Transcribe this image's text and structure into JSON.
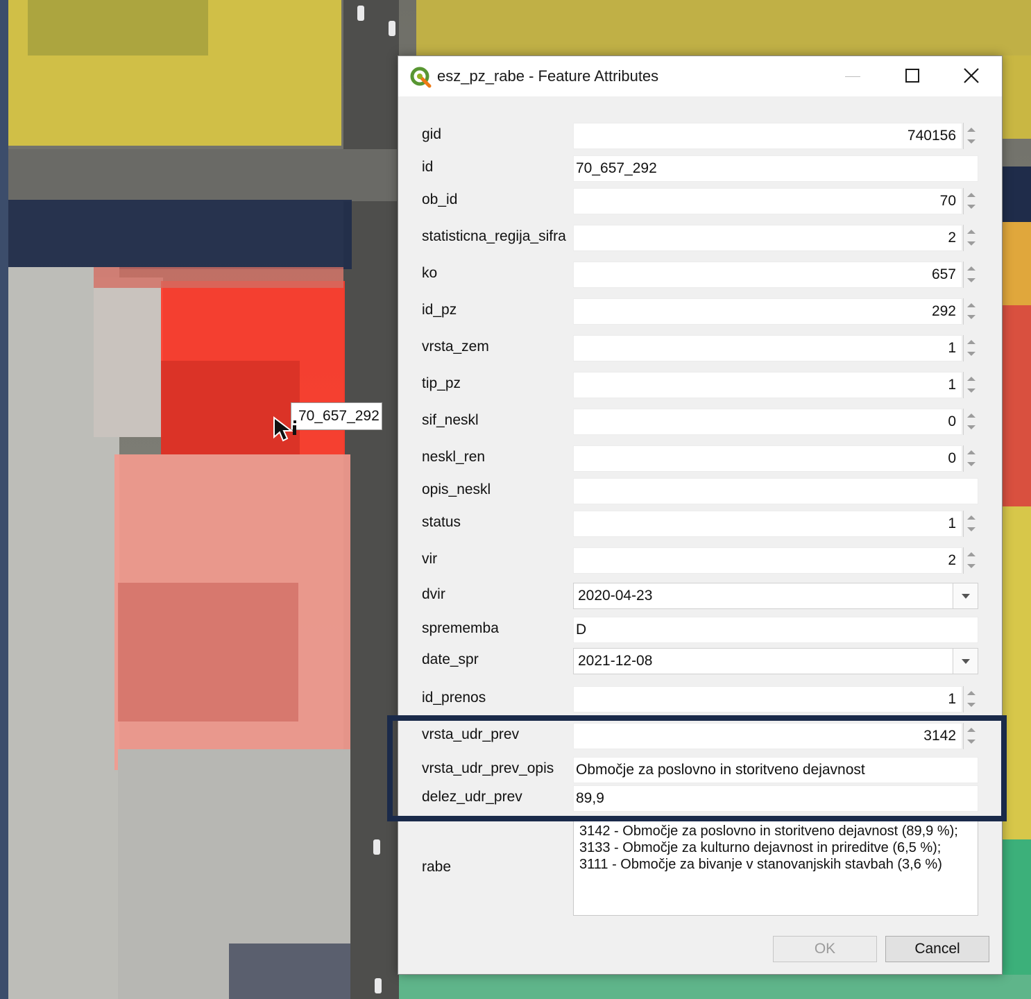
{
  "dialog": {
    "title": "esz_pz_rabe - Feature Attributes",
    "fields": [
      {
        "label": "gid",
        "value": "740156",
        "kind": "spin"
      },
      {
        "label": "id",
        "value": "70_657_292",
        "kind": "text"
      },
      {
        "label": "ob_id",
        "value": "70",
        "kind": "spin"
      },
      {
        "label": "statisticna_regija_sifra",
        "value": "2",
        "kind": "spin"
      },
      {
        "label": "ko",
        "value": "657",
        "kind": "spin"
      },
      {
        "label": "id_pz",
        "value": "292",
        "kind": "spin"
      },
      {
        "label": "vrsta_zem",
        "value": "1",
        "kind": "spin"
      },
      {
        "label": "tip_pz",
        "value": "1",
        "kind": "spin"
      },
      {
        "label": "sif_neskl",
        "value": "0",
        "kind": "spin"
      },
      {
        "label": "neskl_ren",
        "value": "0",
        "kind": "spin"
      },
      {
        "label": "opis_neskl",
        "value": "",
        "kind": "text"
      },
      {
        "label": "status",
        "value": "1",
        "kind": "spin"
      },
      {
        "label": "vir",
        "value": "2",
        "kind": "spin"
      },
      {
        "label": "dvir",
        "value": "2020-04-23",
        "kind": "date"
      },
      {
        "label": "sprememba",
        "value": "D",
        "kind": "text"
      },
      {
        "label": "date_spr",
        "value": "2021-12-08",
        "kind": "date"
      },
      {
        "label": "id_prenos",
        "value": "1",
        "kind": "spin"
      },
      {
        "label": "vrsta_udr_prev",
        "value": "3142",
        "kind": "spin"
      },
      {
        "label": "vrsta_udr_prev_opis",
        "value": "Območje za poslovno in storitveno dejavnost",
        "kind": "text"
      },
      {
        "label": "delez_udr_prev",
        "value": "89,9",
        "kind": "text"
      }
    ],
    "rabe": {
      "label": "rabe",
      "value": "3142 - Območje za poslovno in storitveno dejavnost (89,9 %); 3133 - Območje za kulturno dejavnost in prireditve (6,5 %); 3111 - Območje za bivanje v stanovanjskih stavbah (3,6 %)"
    },
    "ok_label": "OK",
    "cancel_label": "Cancel"
  },
  "map": {
    "tooltip": "70_657_292",
    "colors": {
      "selected": "#ff3b2a",
      "zone_pink": "#f7a79c",
      "zone_yellow": "#e9d64a",
      "zone_green": "#3cb07a"
    }
  },
  "icons": {
    "app": "qgis-icon",
    "minimize": "minimize-icon",
    "maximize": "maximize-icon",
    "close": "close-icon",
    "cursor": "identify-cursor-icon"
  }
}
